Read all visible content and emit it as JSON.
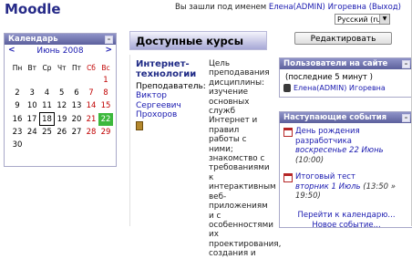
{
  "header": {
    "site_title": "Moodle",
    "login_prefix": "Вы зашли под именем ",
    "user_name": "Елена(ADMIN) Игоревна",
    "logout": "(Выход)",
    "language": "Русский (ru)"
  },
  "calendar": {
    "title": "Календарь",
    "prev": "<",
    "next": ">",
    "month": "Июнь 2008",
    "weekdays": [
      "Пн",
      "Вт",
      "Ср",
      "Чт",
      "Пт",
      "Сб",
      "Вс"
    ],
    "weeks": [
      [
        "",
        "",
        "",
        "",
        "",
        "",
        "1"
      ],
      [
        "2",
        "3",
        "4",
        "5",
        "6",
        "7",
        "8"
      ],
      [
        "9",
        "10",
        "11",
        "12",
        "13",
        "14",
        "15"
      ],
      [
        "16",
        "17",
        "18",
        "19",
        "20",
        "21",
        "22"
      ],
      [
        "23",
        "24",
        "25",
        "26",
        "27",
        "28",
        "29"
      ],
      [
        "30",
        "",
        "",
        "",
        "",
        "",
        ""
      ]
    ],
    "today": "18",
    "event_day": "22"
  },
  "courses": {
    "heading": "Доступные курсы",
    "title_line1": "Интернет-",
    "title_line2": "технологии",
    "teacher_label": "Преподаватель:",
    "teacher_line1": "Виктор",
    "teacher_line2": "Сергеевич",
    "teacher_line3": "Прохоров",
    "description": "Цель преподавания дисциплины: изучение основных служб Интернет и правил работы с ними; знакомство с требованиями к интерактивным веб-приложениям и с особенностями их проектирования, создания и"
  },
  "edit_button": "Редактировать",
  "online_users": {
    "title": "Пользователи на сайте",
    "subtitle": "(последние 5 минут )",
    "user": "Елена(ADMIN) Игоревна"
  },
  "events": {
    "title": "Наступающие события",
    "items": [
      {
        "title": "День рождения разработчика",
        "date": "воскресенье 22 Июнь",
        "time": "(10:00)"
      },
      {
        "title": "Итоговый тест",
        "date": "вторник 1 Июль",
        "time": "(13:50 » 19:50)"
      }
    ],
    "goto_calendar": "Перейти к календарю...",
    "new_event": "Новое событие..."
  },
  "colors": {
    "block_header": "#6b6fa8",
    "link": "#1a1ab0",
    "weekend": "#c00000",
    "event_day": "#3cb83c"
  }
}
